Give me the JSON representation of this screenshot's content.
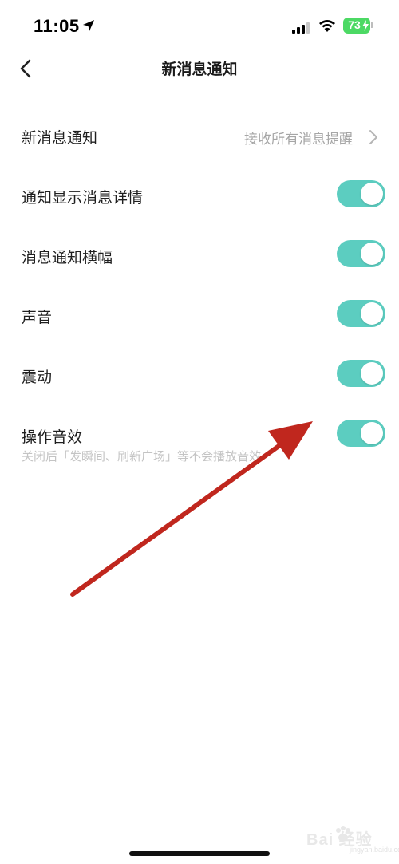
{
  "status_bar": {
    "time": "11:05",
    "battery_level": "73",
    "icons": [
      "location-arrow-icon",
      "cellular-signal-icon",
      "wifi-icon",
      "battery-charging-icon"
    ]
  },
  "nav": {
    "title": "新消息通知",
    "back_icon": "chevron-left-icon"
  },
  "settings": [
    {
      "label": "新消息通知",
      "value": "接收所有消息提醒",
      "type": "link"
    },
    {
      "label": "通知显示消息详情",
      "type": "toggle",
      "on": true
    },
    {
      "label": "消息通知横幅",
      "type": "toggle",
      "on": true
    },
    {
      "label": "声音",
      "type": "toggle",
      "on": true
    },
    {
      "label": "震动",
      "type": "toggle",
      "on": true
    },
    {
      "label": "操作音效",
      "type": "toggle",
      "on": true,
      "hint": "关闭后「发瞬间、刷新广场」等不会播放音效"
    }
  ],
  "colors": {
    "toggle_on": "#5ccdc0",
    "annotation_arrow": "#c0271e",
    "battery": "#4cd964"
  },
  "watermark": {
    "text": "Bai 经验",
    "sub": "jingyan.baidu.com"
  }
}
